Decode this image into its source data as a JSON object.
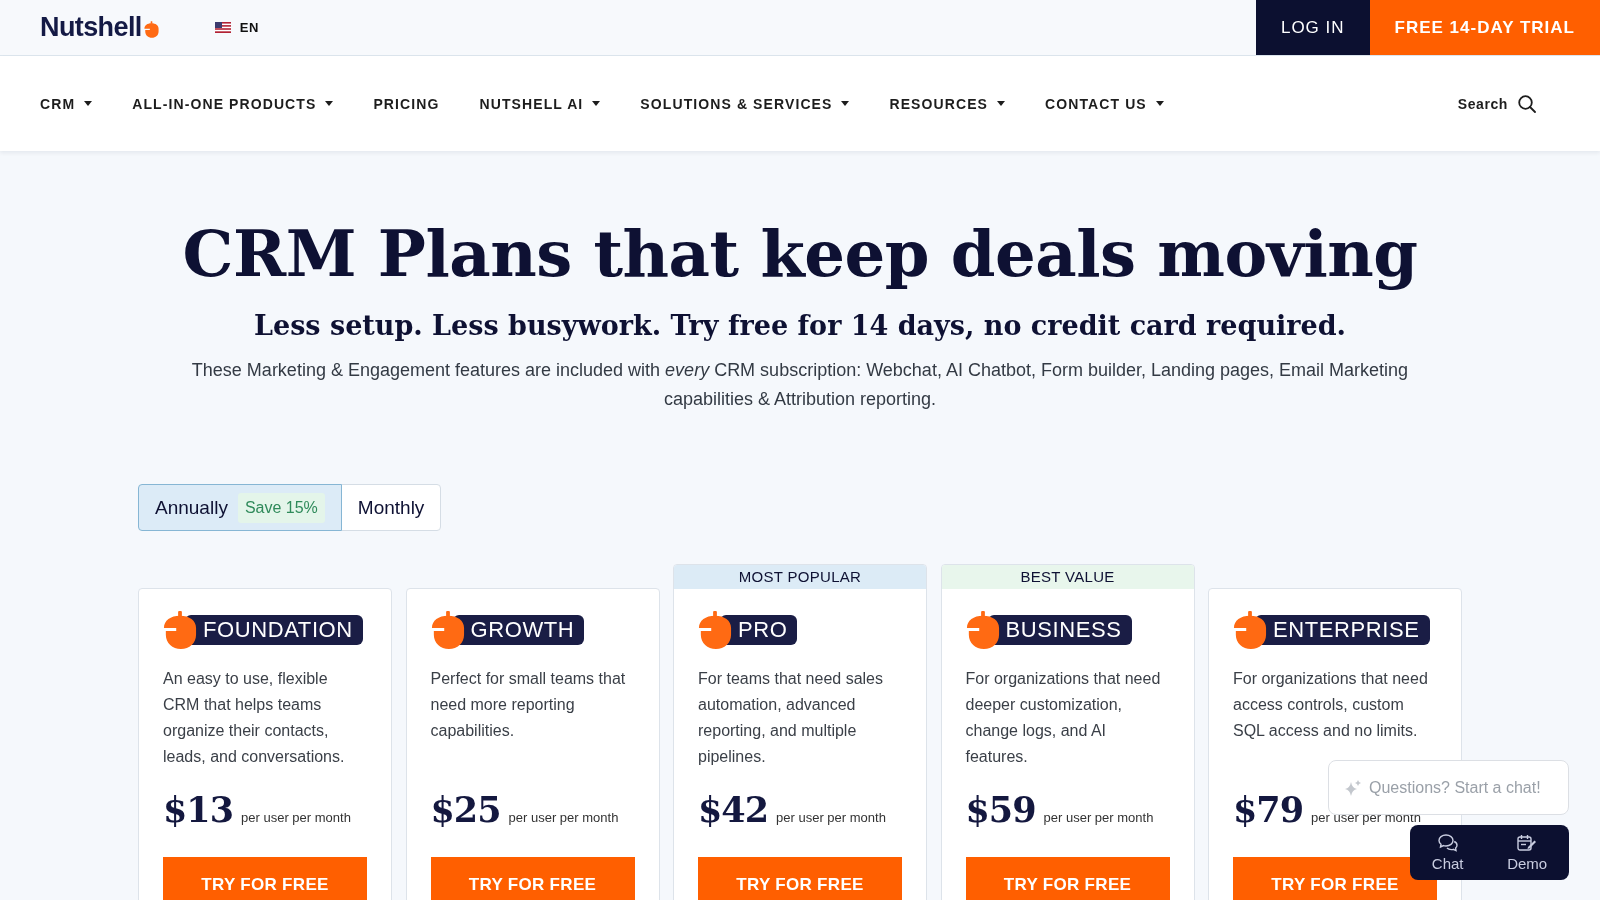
{
  "top_bar": {
    "logo": "Nutshell",
    "language": "EN",
    "buttons": [
      {
        "label": "LOG IN",
        "kind": "secondary"
      },
      {
        "label": "FREE 14-DAY TRIAL",
        "kind": "primary"
      }
    ]
  },
  "nav": {
    "items": [
      {
        "label": "CRM",
        "dropdown": true
      },
      {
        "label": "ALL-IN-ONE PRODUCTS",
        "dropdown": true
      },
      {
        "label": "PRICING",
        "dropdown": false
      },
      {
        "label": "NUTSHELL AI",
        "dropdown": true
      },
      {
        "label": "SOLUTIONS & SERVICES",
        "dropdown": true
      },
      {
        "label": "RESOURCES",
        "dropdown": true
      },
      {
        "label": "CONTACT US",
        "dropdown": true
      }
    ],
    "search": "Search"
  },
  "hero": {
    "title": "CRM Plans that keep deals moving",
    "subtitle": "Less setup. Less busywork. Try free for 14 days, no credit card required.",
    "description": "These Marketing & Engagement features are included with *every* CRM subscription: Webchat, AI Chatbot, Form builder, Landing pages, Email Marketing capabilities & Attribution reporting."
  },
  "billing_toggle": {
    "options": [
      {
        "label": "Annually",
        "badge": "Save 15%",
        "selected": true
      },
      {
        "label": "Monthly",
        "selected": false
      }
    ]
  },
  "plans": [
    {
      "name": "FOUNDATION",
      "description": "An easy to use, flexible CRM that helps teams organize their contacts, leads, and conversations.",
      "price": "$13",
      "price_unit": "per user per month",
      "cta": "TRY FOR FREE"
    },
    {
      "name": "GROWTH",
      "description": "Perfect for small teams that need more reporting capabilities.",
      "price": "$25",
      "price_unit": "per user per month",
      "cta": "TRY FOR FREE"
    },
    {
      "name": "PRO",
      "ribbon": {
        "label": "MOST POPULAR",
        "color": "#dcebf6"
      },
      "description": "For teams that need sales automation, advanced reporting, and multiple pipelines.",
      "price": "$42",
      "price_unit": "per user per month",
      "cta": "TRY FOR FREE"
    },
    {
      "name": "BUSINESS",
      "ribbon": {
        "label": "BEST VALUE",
        "color": "#e8f6ec"
      },
      "description": "For organizations that need deeper customization, change logs, and AI features.",
      "price": "$59",
      "price_unit": "per user per month",
      "cta": "TRY FOR FREE"
    },
    {
      "name": "ENTERPRISE",
      "description": "For organizations that need access controls, custom SQL access and no limits.",
      "price": "$79",
      "price_unit": "per user per month",
      "cta": "TRY FOR FREE"
    }
  ],
  "chat_widget": {
    "prompt": "Questions? Start a chat!",
    "buttons": [
      {
        "label": "Chat",
        "kind": "chat"
      },
      {
        "label": "Demo",
        "kind": "demo"
      }
    ]
  }
}
